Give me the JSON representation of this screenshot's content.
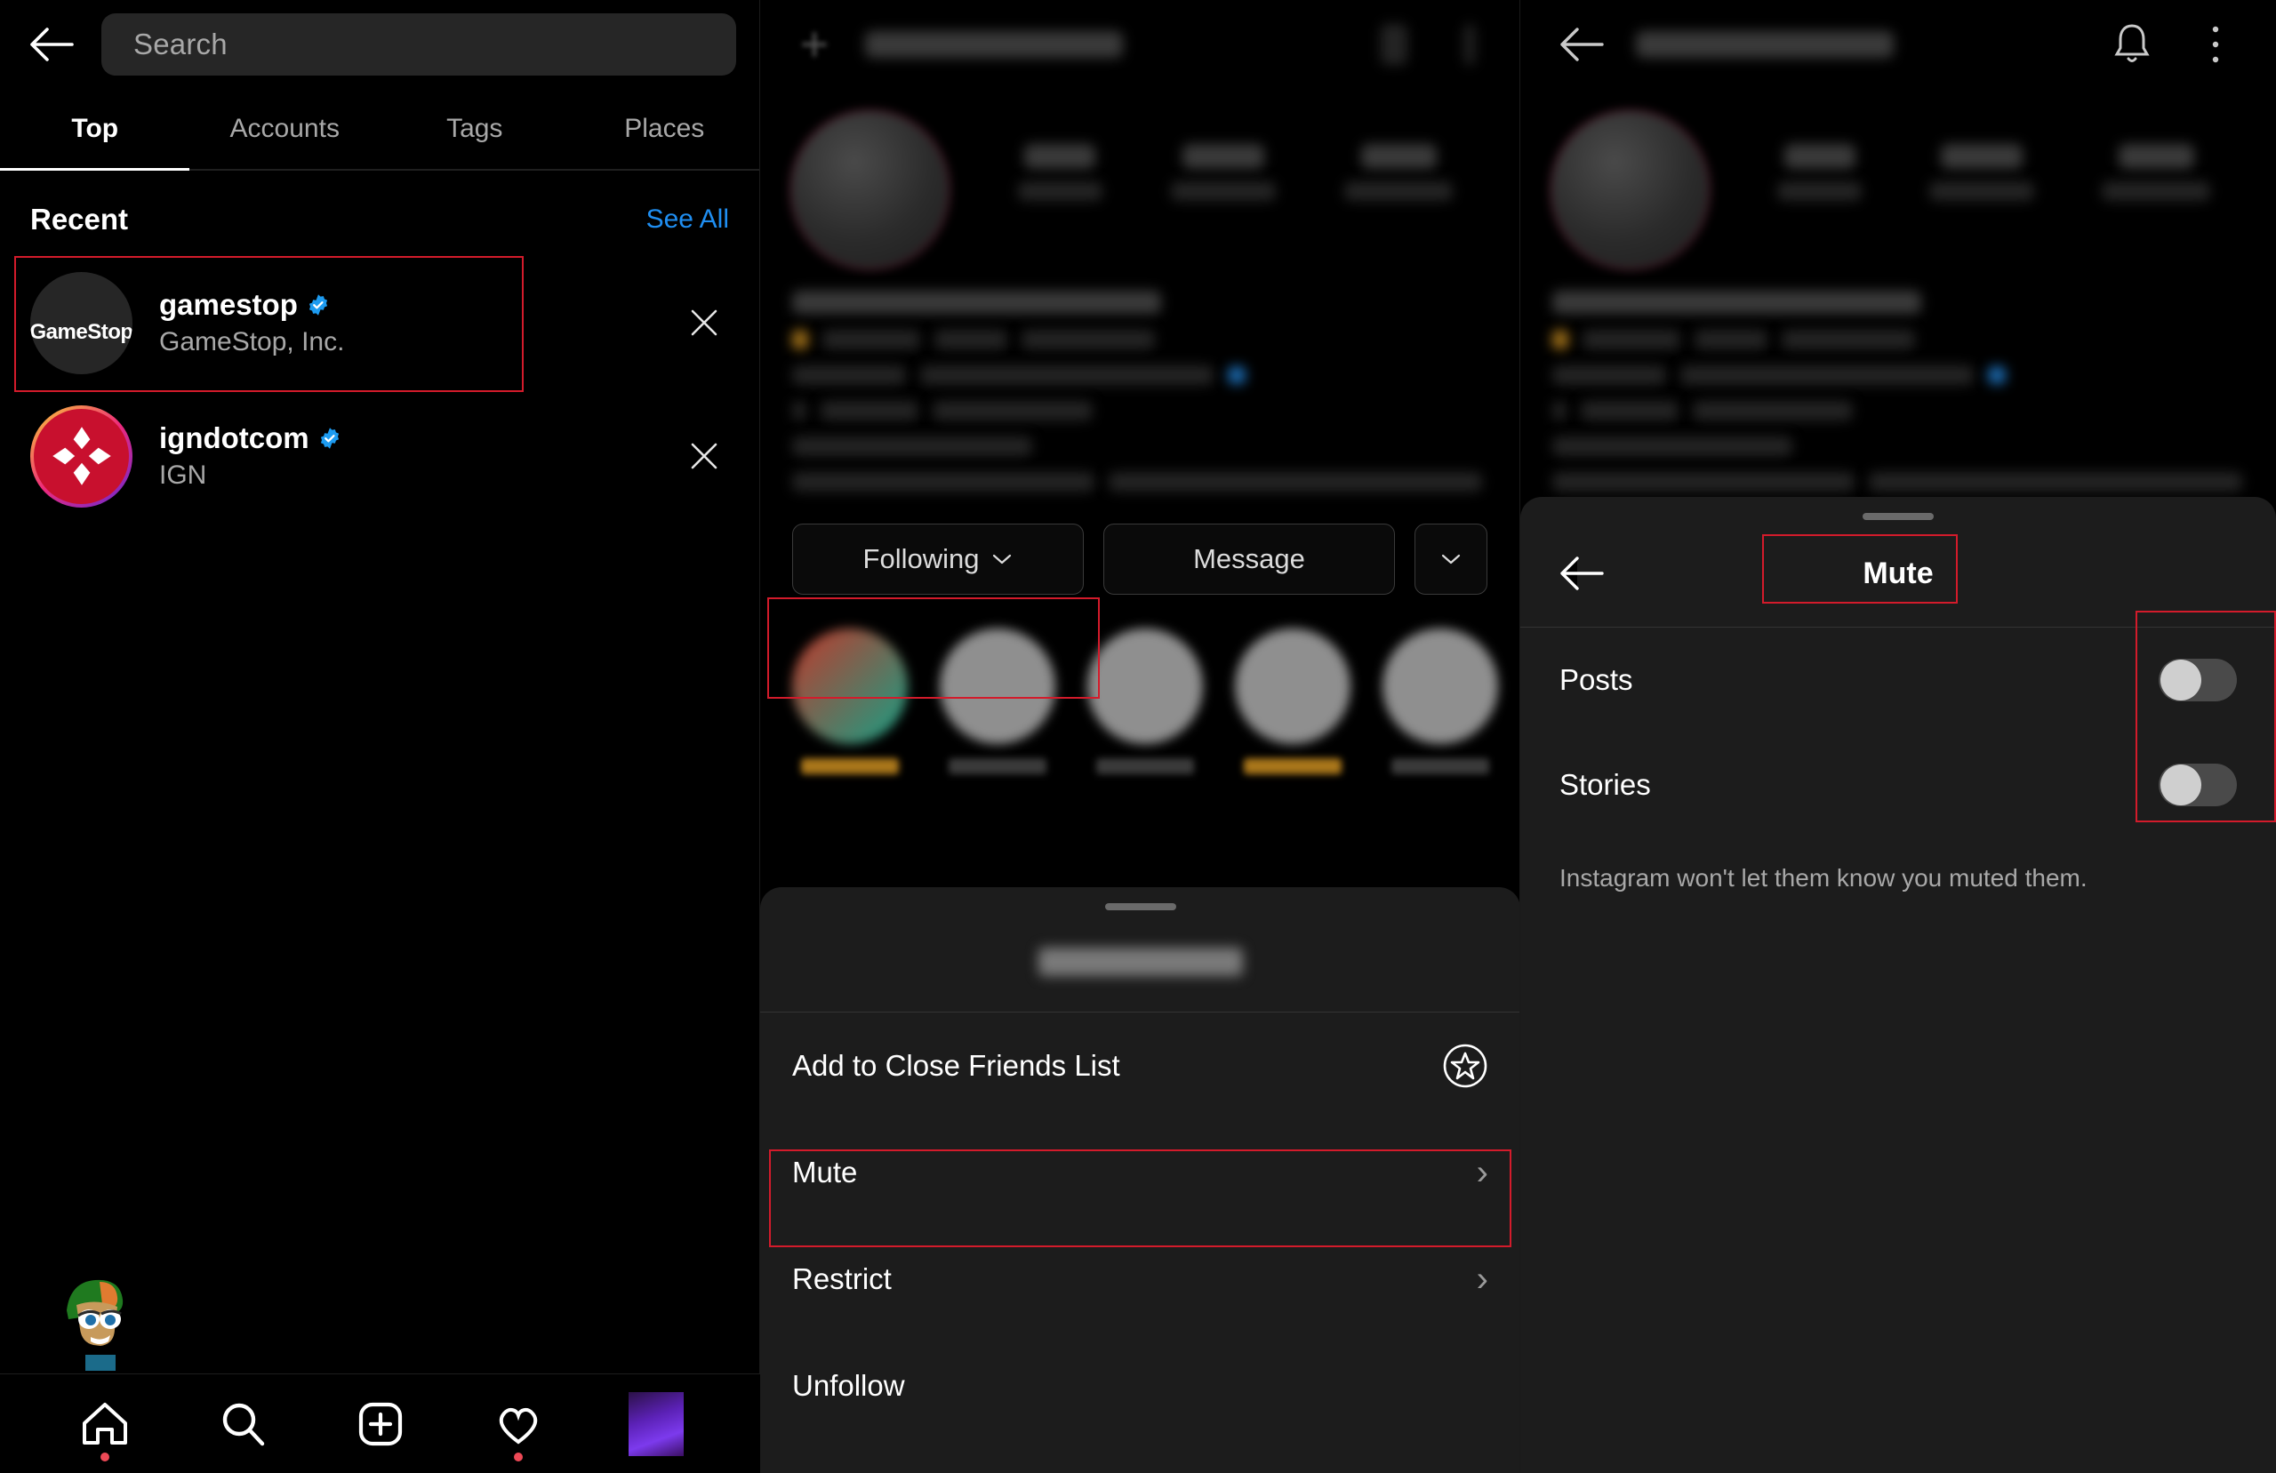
{
  "search_panel": {
    "back_icon": "back-arrow-icon",
    "search": {
      "placeholder": "Search",
      "value": ""
    },
    "tabs": [
      {
        "label": "Top",
        "active": true
      },
      {
        "label": "Accounts",
        "active": false
      },
      {
        "label": "Tags",
        "active": false
      },
      {
        "label": "Places",
        "active": false
      }
    ],
    "recent": {
      "title": "Recent",
      "see_all_label": "See All",
      "see_all_color": "#1f8ef1",
      "items": [
        {
          "username": "gamestop",
          "subtitle": "GameStop, Inc.",
          "verified": true,
          "avatar_text": "GameStop",
          "avatar_kind": "gamestop-logo",
          "highlighted": true,
          "remove_icon": "close-icon"
        },
        {
          "username": "igndotcom",
          "subtitle": "IGN",
          "verified": true,
          "avatar_text": "",
          "avatar_kind": "ign-logo-story-ring",
          "highlighted": false,
          "remove_icon": "close-icon"
        }
      ]
    },
    "bottom_nav": [
      {
        "name": "home",
        "icon": "home-icon",
        "dot": true
      },
      {
        "name": "search",
        "icon": "search-icon",
        "dot": false
      },
      {
        "name": "create",
        "icon": "plus-square-icon",
        "dot": false
      },
      {
        "name": "activity",
        "icon": "heart-icon",
        "dot": true
      },
      {
        "name": "profile",
        "icon": "profile-avatar-icon",
        "dot": false
      }
    ]
  },
  "profile_panel": {
    "back_icon": "plus-icon",
    "title_redacted": true,
    "actions": {
      "following_label": "Following",
      "following_caret": "chevron-down-icon",
      "message_label": "Message",
      "more_caret": "chevron-down-icon",
      "following_highlighted": true
    },
    "sheet": {
      "grabber": true,
      "title_redacted": true,
      "items": [
        {
          "label": "Add to Close Friends List",
          "trailing": "star-circle-icon",
          "highlighted": false
        },
        {
          "label": "Mute",
          "trailing": "chevron-right-icon",
          "highlighted": true
        },
        {
          "label": "Restrict",
          "trailing": "chevron-right-icon",
          "highlighted": false
        },
        {
          "label": "Unfollow",
          "trailing": "",
          "highlighted": false
        }
      ]
    }
  },
  "mute_panel": {
    "topbar": {
      "back_icon": "back-arrow-icon",
      "title_redacted": true,
      "bell_icon": "bell-icon",
      "more_icon": "more-vertical-icon"
    },
    "sheet": {
      "back_icon": "back-arrow-icon",
      "title": "Mute",
      "title_highlighted": true,
      "toggles_highlighted": true,
      "rows": [
        {
          "label": "Posts",
          "enabled": false
        },
        {
          "label": "Stories",
          "enabled": false
        }
      ],
      "note": "Instagram won't let them know you muted them."
    }
  },
  "annotation": {
    "highlight_color": "#d31b2b"
  }
}
